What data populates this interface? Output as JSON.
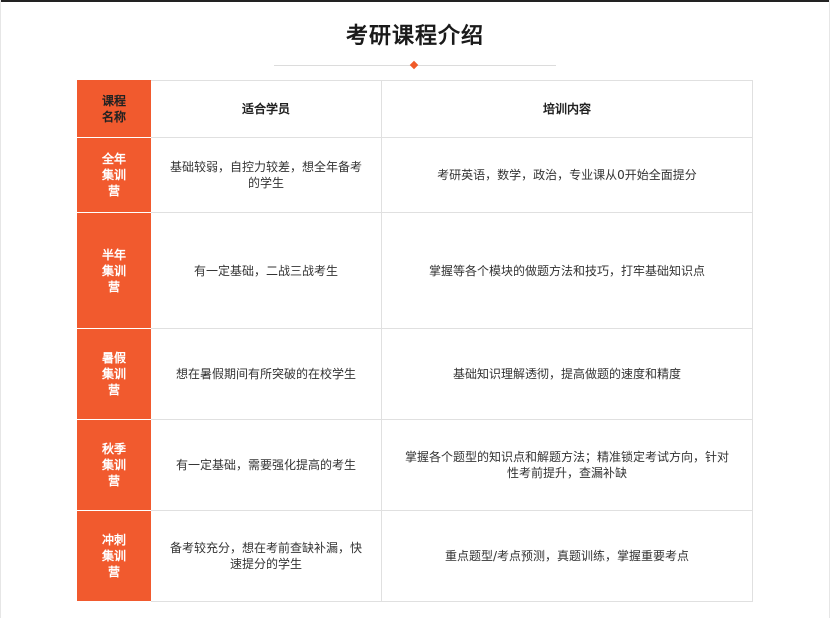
{
  "page": {
    "title": "考研课程介绍",
    "accent_color": "#f15a2e"
  },
  "table": {
    "headers": [
      "课程名称",
      "适合学员",
      "培训内容"
    ],
    "rows": [
      {
        "name": "全年集训营",
        "audience": "基础较弱，自控力较差，想全年备考的学生",
        "content": "考研英语，数学，政治，专业课从0开始全面提分"
      },
      {
        "name": "半年集训营",
        "audience": "有一定基础，二战三战考生",
        "content": "掌握等各个模块的做题方法和技巧，打牢基础知识点"
      },
      {
        "name": "暑假集训营",
        "audience": "想在暑假期间有所突破的在校学生",
        "content": "基础知识理解透彻，提高做题的速度和精度"
      },
      {
        "name": "秋季集训营",
        "audience": "有一定基础，需要强化提高的考生",
        "content": "掌握各个题型的知识点和解题方法；精准锁定考试方向，针对性考前提升，查漏补缺"
      },
      {
        "name": "冲刺集训营",
        "audience": "备考较充分，想在考前查缺补漏，快速提分的学生",
        "content": "重点题型/考点预测，真题训练，掌握重要考点"
      }
    ]
  }
}
